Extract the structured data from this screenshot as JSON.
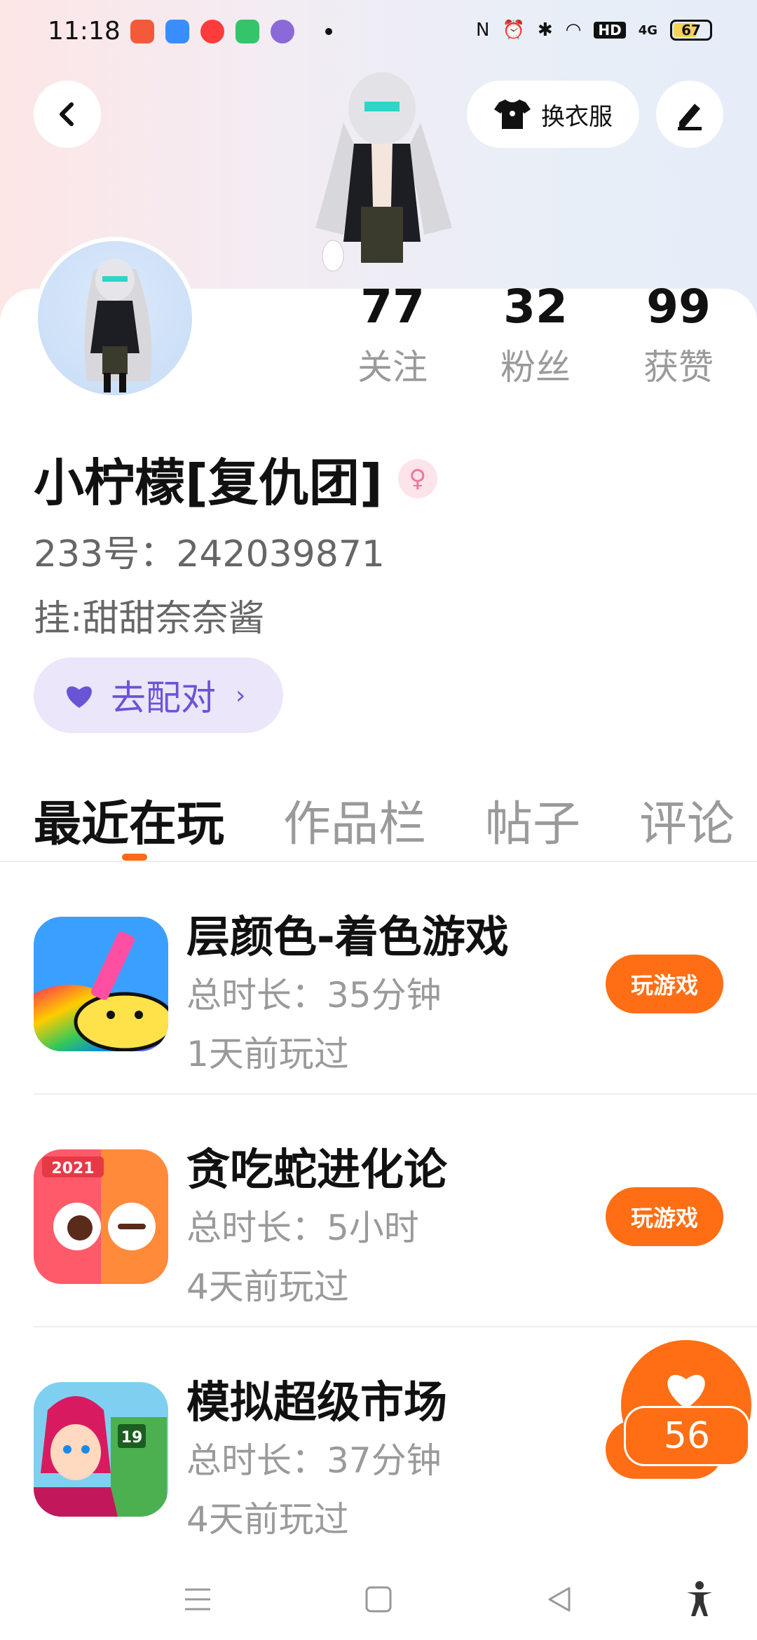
{
  "status_bar": {
    "time": "11:18",
    "right_labels": [
      "HD",
      "4G"
    ],
    "battery": "67"
  },
  "header": {
    "outfit_label": "换衣服",
    "icons": [
      "back-arrow-icon",
      "tshirt-icon",
      "edit-pen-icon"
    ]
  },
  "profile": {
    "stats": [
      {
        "value": "77",
        "label": "关注"
      },
      {
        "value": "32",
        "label": "粉丝"
      },
      {
        "value": "99",
        "label": "获赞"
      }
    ],
    "nickname": "小柠檬[复仇团]",
    "gender_symbol": "♀",
    "account_id": "233号：242039871",
    "tag": "挂:甜甜奈奈酱",
    "match_label": "去配对",
    "match_chevron": "›"
  },
  "tabs": [
    {
      "label": "最近在玩",
      "active": true
    },
    {
      "label": "作品栏",
      "active": false
    },
    {
      "label": "帖子",
      "active": false
    },
    {
      "label": "评论",
      "active": false
    }
  ],
  "games": [
    {
      "name": "层颜色-着色游戏",
      "duration": "总时长：35分钟",
      "last_played": "1天前玩过",
      "button": "玩游戏"
    },
    {
      "name": "贪吃蛇进化论",
      "duration": "总时长：5小时",
      "last_played": "4天前玩过",
      "button": "玩游戏",
      "badge": "2021"
    },
    {
      "name": "模拟超级市场",
      "duration": "总时长：37分钟",
      "last_played": "4天前玩过",
      "button": "玩游戏",
      "badge": "19"
    }
  ],
  "like_fab": {
    "count": "56"
  },
  "colors": {
    "accent": "#ff6e14",
    "match_bg": "#ece6fb",
    "match_text": "#6a54d6"
  }
}
